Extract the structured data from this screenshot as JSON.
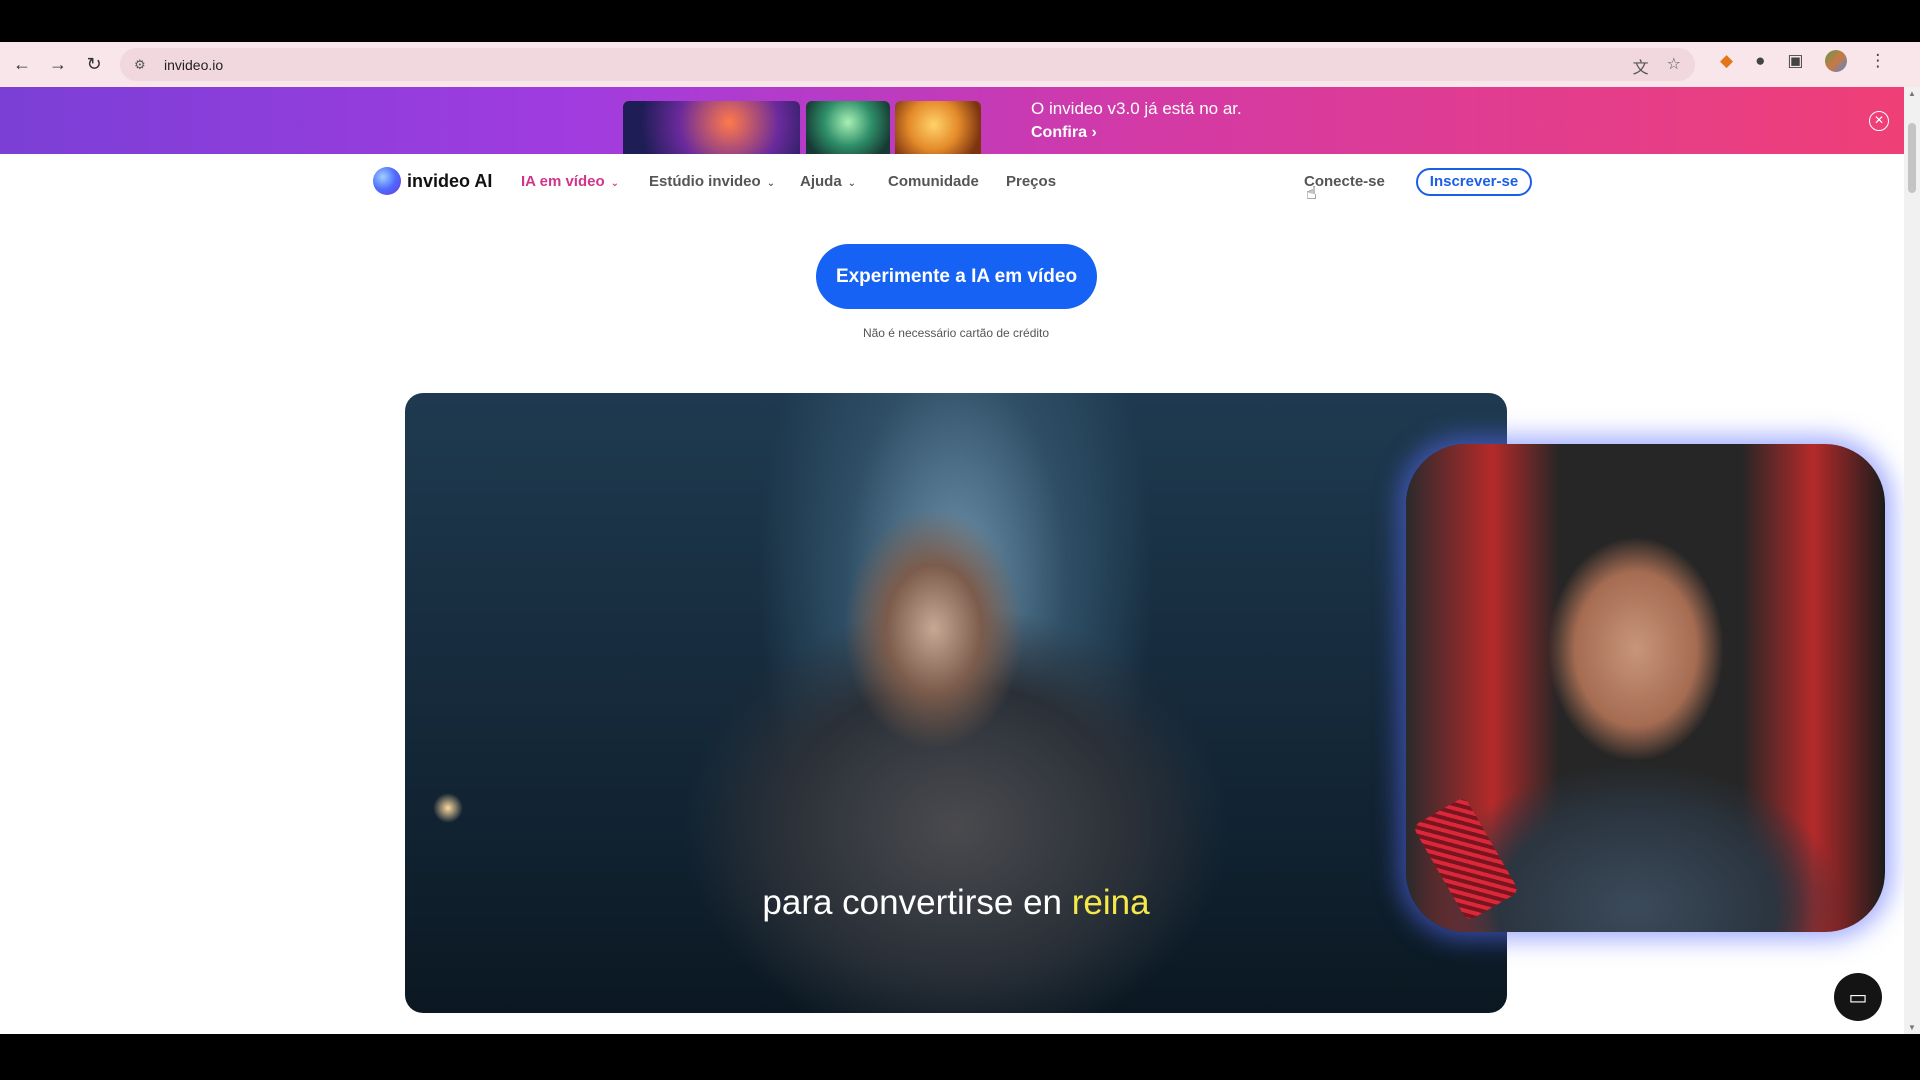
{
  "browser": {
    "url": "invideo.io",
    "icons": [
      "back-icon",
      "forward-icon",
      "reload-icon",
      "site-settings-icon",
      "translate-icon",
      "star-icon",
      "extension-fox-icon",
      "extension-mouse-icon",
      "extensions-puzzle-icon",
      "profile-avatar",
      "menu-icon"
    ]
  },
  "banner": {
    "title": "O invideo v3.0 já está no ar.",
    "cta_label": "Confira",
    "close_icon": "close-icon"
  },
  "nav": {
    "logo_text": "invideo AI",
    "items": [
      {
        "label": "IA em vídeo",
        "active": true,
        "dropdown": true
      },
      {
        "label": "Estúdio invideo",
        "dropdown": true
      },
      {
        "label": "Ajuda",
        "dropdown": true
      },
      {
        "label": "Comunidade"
      },
      {
        "label": "Preços"
      }
    ],
    "login_label": "Conecte-se",
    "signup_label": "Inscrever-se"
  },
  "hero": {
    "cta_label": "Experimente a IA em vídeo",
    "cta_note": "Não é necessário cartão de crédito"
  },
  "video": {
    "caption_prefix": "para convertirse en",
    "caption_highlight": "reina"
  },
  "colors": {
    "accent": "#1662f4",
    "nav_active": "#d0358a",
    "caption_highlight": "#f5e84a"
  }
}
